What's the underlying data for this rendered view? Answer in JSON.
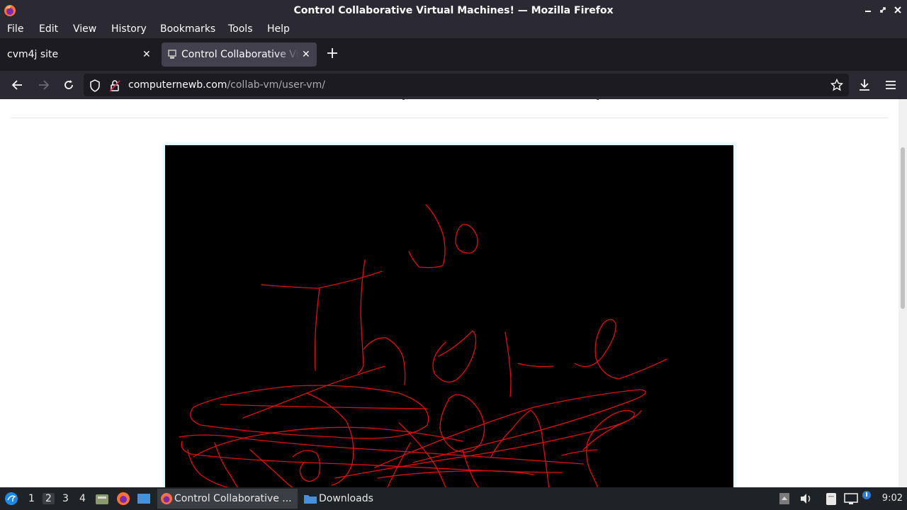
{
  "window": {
    "title": "Control Collaborative Virtual Machines! — Mozilla Firefox"
  },
  "menu": [
    "File",
    "Edit",
    "View",
    "History",
    "Bookmarks",
    "Tools",
    "Help"
  ],
  "tabs": [
    {
      "label": "cvm4j site",
      "active": false
    },
    {
      "label": "Control Collaborative Virt",
      "active": true
    }
  ],
  "address": {
    "host": "computernewb.com",
    "path": "/collab-vm/user-vm/"
  },
  "taskbar": {
    "workspaces": [
      "1",
      "2",
      "3",
      "4"
    ],
    "active_workspace": "2",
    "tasks": [
      {
        "label": "Control Collaborative ..."
      },
      {
        "label": "Downloads"
      }
    ],
    "clock": "9:02"
  },
  "colors": {
    "scribble": "#e01010",
    "vm_background": "#000000",
    "vm_glow": "#c8f2ff"
  },
  "icons": [
    "firefox-icon",
    "back-arrow-icon",
    "forward-arrow-icon",
    "reload-icon",
    "shield-icon",
    "lock-icon",
    "star-icon",
    "download-icon",
    "hamburger-menu-icon",
    "new-tab-icon",
    "close-icon"
  ]
}
